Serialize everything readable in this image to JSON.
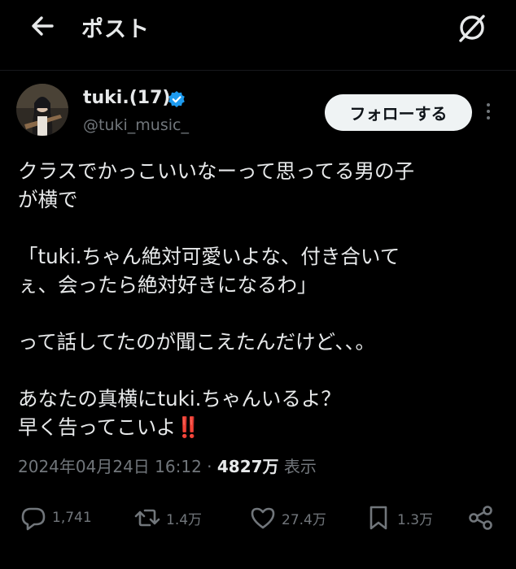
{
  "header": {
    "title": "ポスト",
    "back_icon": "arrow-left-icon",
    "grok_icon": "grok-icon"
  },
  "author": {
    "display_name": "tuki.(17)",
    "handle": "@tuki_music_",
    "verified_color": "#1d9bf0",
    "follow_label": "フォローする"
  },
  "tweet": {
    "lines": [
      "クラスでかっこいいなーって思ってる男の子",
      "が横で",
      "「tuki.ちゃん絶対可愛いよな、付き合いて",
      "ぇ、会ったら絶対好きになるわ」",
      "って話してたのが聞こえたんだけど､､。",
      "あなたの真横にtuki.ちゃんいるよ？",
      "早く告ってこいよ",
      "‼️"
    ]
  },
  "meta": {
    "timestamp": "2024年04月24日 16:12",
    "separator": "·",
    "views_count": "4827万",
    "views_label": "表示"
  },
  "actions": {
    "replies": "1,741",
    "reposts": "1.4万",
    "likes": "27.4万",
    "bookmarks": "1.3万"
  },
  "colors": {
    "background": "#000000",
    "text": "#e7e9ea",
    "muted": "#71767b",
    "verified": "#1d9bf0"
  }
}
